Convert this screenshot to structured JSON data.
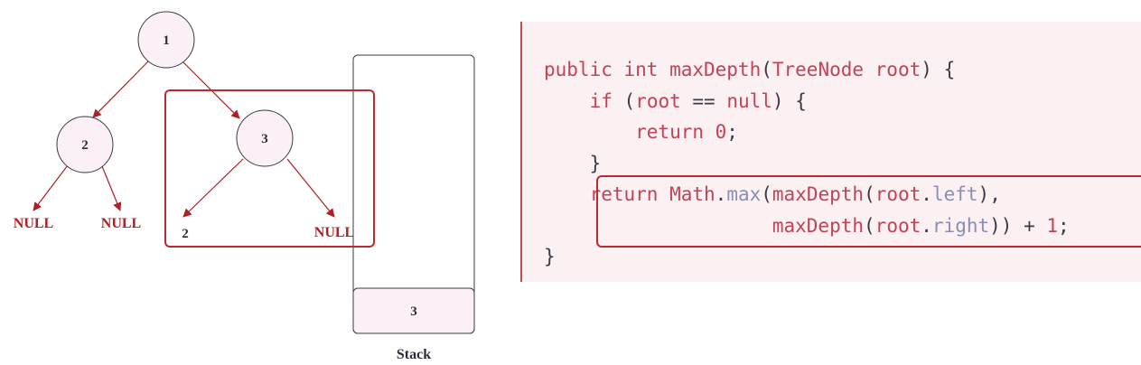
{
  "tree": {
    "nodes": [
      {
        "id": "1",
        "label": "1"
      },
      {
        "id": "2",
        "label": "2"
      },
      {
        "id": "3",
        "label": "3"
      }
    ],
    "null_labels": [
      "NULL",
      "NULL",
      "NULL"
    ],
    "leaf_label": "2"
  },
  "stack": {
    "items": [
      "3"
    ],
    "caption": "Stack"
  },
  "code": {
    "lines": [
      "public int maxDepth(TreeNode root) {",
      "    if (root == null) {",
      "        return 0;",
      "    }",
      "    return Math.max(maxDepth(root.left),",
      "                    maxDepth(root.right)) + 1;",
      "}"
    ]
  },
  "colors": {
    "accent": "#c0282f",
    "node_fill": "#fbf0f6",
    "code_bg": "#fbf0f2"
  }
}
